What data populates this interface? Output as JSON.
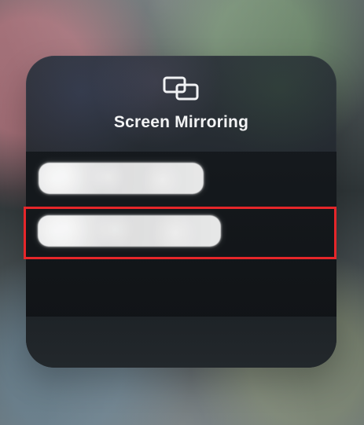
{
  "modal": {
    "title": "Screen Mirroring",
    "icon": "screen-mirroring-icon"
  },
  "devices": [
    {
      "label": ""
    },
    {
      "label": ""
    }
  ],
  "colors": {
    "selection_outline": "#e6262a"
  }
}
